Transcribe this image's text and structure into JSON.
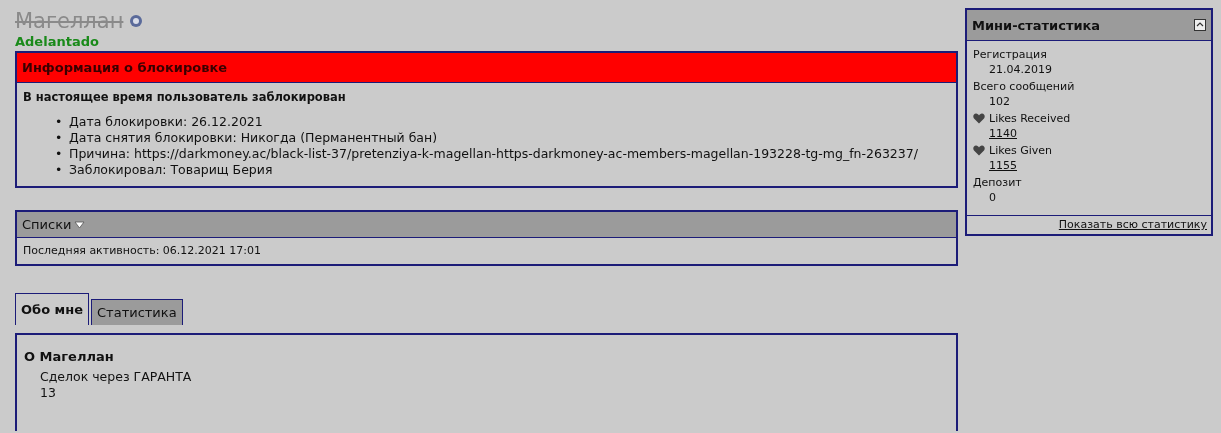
{
  "profile": {
    "username": "Магеллан",
    "banned": true,
    "online": false,
    "user_title": "Adelantado"
  },
  "ban_info": {
    "title": "Информация о блокировке",
    "notice": "В настоящее время пользователь заблокирован",
    "details": [
      {
        "bullet": "•",
        "text": "Дата блокировки: 26.12.2021"
      },
      {
        "bullet": "•",
        "text": "Дата снятия блокировки: Никогда (Перманентный бан)"
      },
      {
        "bullet": "•",
        "text": "Причина: https://darkmoney.ac/black-list-37/pretenziya-k-magellan-https-darkmoney-ac-members-magellan-193228-tg-mg_fn-263237/"
      },
      {
        "bullet": "•",
        "text": "Заблокировал: Товарищ Берия"
      }
    ]
  },
  "lists": {
    "title": "Списки",
    "last_activity": "Последняя активность: 06.12.2021 17:01"
  },
  "tabs": [
    {
      "label": "Обо мне",
      "selected": true
    },
    {
      "label": "Статистика",
      "selected": false
    }
  ],
  "about": {
    "title": "О Магеллан",
    "fields": [
      {
        "label": "Сделок через ГАРАНТА",
        "value": "13"
      }
    ]
  },
  "mini_stats": {
    "title": "Мини-статистика",
    "items": [
      {
        "kind": "plain",
        "label": "Регистрация",
        "value": "21.04.2019"
      },
      {
        "kind": "plain",
        "label": "Всего сообщений",
        "value": "102"
      },
      {
        "kind": "like",
        "label": "Likes Received",
        "value": "1140"
      },
      {
        "kind": "like",
        "label": "Likes Given",
        "value": "1155"
      },
      {
        "kind": "plain",
        "label": "Депозит",
        "value": "0"
      }
    ],
    "footer_link": "Показать всю статистику"
  }
}
